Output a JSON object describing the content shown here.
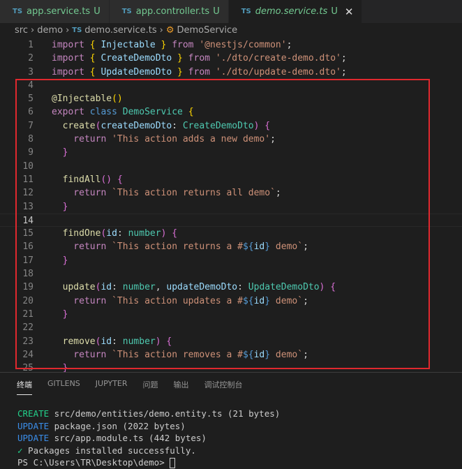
{
  "tabs": [
    {
      "file_type": "TS",
      "label": "app.service.ts",
      "status": "U"
    },
    {
      "file_type": "TS",
      "label": "app.controller.ts",
      "status": "U"
    },
    {
      "file_type": "TS",
      "label": "demo.service.ts",
      "status": "U",
      "active": true
    }
  ],
  "breadcrumb": {
    "parts": [
      "src",
      "demo"
    ],
    "file_type": "TS",
    "file": "demo.service.ts",
    "symbol": "DemoService"
  },
  "editor": {
    "current_line": 14,
    "lines": [
      [
        [
          "import",
          "k"
        ],
        [
          " ",
          "w"
        ],
        [
          "{",
          "p1"
        ],
        [
          " Injectable ",
          "v"
        ],
        [
          "}",
          "p1"
        ],
        [
          " from ",
          "k"
        ],
        [
          "'@nestjs/common'",
          "s"
        ],
        [
          ";",
          "w"
        ]
      ],
      [
        [
          "import",
          "k"
        ],
        [
          " ",
          "w"
        ],
        [
          "{",
          "p1"
        ],
        [
          " CreateDemoDto ",
          "v"
        ],
        [
          "}",
          "p1"
        ],
        [
          " from ",
          "k"
        ],
        [
          "'./dto/create-demo.dto'",
          "s"
        ],
        [
          ";",
          "w"
        ]
      ],
      [
        [
          "import",
          "k"
        ],
        [
          " ",
          "w"
        ],
        [
          "{",
          "p1"
        ],
        [
          " UpdateDemoDto ",
          "v"
        ],
        [
          "}",
          "p1"
        ],
        [
          " from ",
          "k"
        ],
        [
          "'./dto/update-demo.dto'",
          "s"
        ],
        [
          ";",
          "w"
        ]
      ],
      [],
      [
        [
          "@",
          "f"
        ],
        [
          "Injectable",
          "f"
        ],
        [
          "()",
          "p1"
        ]
      ],
      [
        [
          "export",
          "k"
        ],
        [
          " class ",
          "b"
        ],
        [
          "DemoService",
          "t"
        ],
        [
          " ",
          "w"
        ],
        [
          "{",
          "p1"
        ]
      ],
      [
        [
          "  create",
          "f"
        ],
        [
          "(",
          "p2"
        ],
        [
          "createDemoDto",
          "v"
        ],
        [
          ": ",
          "w"
        ],
        [
          "CreateDemoDto",
          "t"
        ],
        [
          ")",
          "p2"
        ],
        [
          " ",
          "w"
        ],
        [
          "{",
          "p2"
        ]
      ],
      [
        [
          "    return",
          "k"
        ],
        [
          " 'This action adds a new demo'",
          "s"
        ],
        [
          ";",
          "w"
        ]
      ],
      [
        [
          "  }",
          "p2"
        ]
      ],
      [],
      [
        [
          "  findAll",
          "f"
        ],
        [
          "()",
          "p2"
        ],
        [
          " ",
          "w"
        ],
        [
          "{",
          "p2"
        ]
      ],
      [
        [
          "    return",
          "k"
        ],
        [
          " `This action returns all demo`",
          "s"
        ],
        [
          ";",
          "w"
        ]
      ],
      [
        [
          "  }",
          "p2"
        ]
      ],
      [],
      [
        [
          "  findOne",
          "f"
        ],
        [
          "(",
          "p2"
        ],
        [
          "id",
          "v"
        ],
        [
          ": ",
          "w"
        ],
        [
          "number",
          "t"
        ],
        [
          ")",
          "p2"
        ],
        [
          " ",
          "w"
        ],
        [
          "{",
          "p2"
        ]
      ],
      [
        [
          "    return",
          "k"
        ],
        [
          " `This action returns a #",
          "s"
        ],
        [
          "${",
          "b"
        ],
        [
          "id",
          "v"
        ],
        [
          "}",
          "b"
        ],
        [
          " demo`",
          "s"
        ],
        [
          ";",
          "w"
        ]
      ],
      [
        [
          "  }",
          "p2"
        ]
      ],
      [],
      [
        [
          "  update",
          "f"
        ],
        [
          "(",
          "p2"
        ],
        [
          "id",
          "v"
        ],
        [
          ": ",
          "w"
        ],
        [
          "number",
          "t"
        ],
        [
          ", ",
          "w"
        ],
        [
          "updateDemoDto",
          "v"
        ],
        [
          ": ",
          "w"
        ],
        [
          "UpdateDemoDto",
          "t"
        ],
        [
          ")",
          "p2"
        ],
        [
          " ",
          "w"
        ],
        [
          "{",
          "p2"
        ]
      ],
      [
        [
          "    return",
          "k"
        ],
        [
          " `This action updates a #",
          "s"
        ],
        [
          "${",
          "b"
        ],
        [
          "id",
          "v"
        ],
        [
          "}",
          "b"
        ],
        [
          " demo`",
          "s"
        ],
        [
          ";",
          "w"
        ]
      ],
      [
        [
          "  }",
          "p2"
        ]
      ],
      [],
      [
        [
          "  remove",
          "f"
        ],
        [
          "(",
          "p2"
        ],
        [
          "id",
          "v"
        ],
        [
          ": ",
          "w"
        ],
        [
          "number",
          "t"
        ],
        [
          ")",
          "p2"
        ],
        [
          " ",
          "w"
        ],
        [
          "{",
          "p2"
        ]
      ],
      [
        [
          "    return",
          "k"
        ],
        [
          " `This action removes a #",
          "s"
        ],
        [
          "${",
          "b"
        ],
        [
          "id",
          "v"
        ],
        [
          "}",
          "b"
        ],
        [
          " demo`",
          "s"
        ],
        [
          ";",
          "w"
        ]
      ],
      [
        [
          "  }",
          "p2"
        ]
      ]
    ]
  },
  "highlight_color": "#e0282e",
  "panel": {
    "tabs": [
      "终端",
      "GITLENS",
      "JUPYTER",
      "问题",
      "输出",
      "调试控制台"
    ],
    "active_tab": "终端",
    "terminal": [
      {
        "tag": "CREATE",
        "text": " src/demo/entities/demo.entity.ts (21 bytes)"
      },
      {
        "tag": "UPDATE",
        "text": " package.json (2022 bytes)"
      },
      {
        "tag": "UPDATE",
        "text": " src/app.module.ts (442 bytes)"
      },
      {
        "tag": "✓",
        "text": " Packages installed successfully."
      }
    ],
    "prompt": "PS C:\\Users\\TR\\Desktop\\demo> "
  }
}
